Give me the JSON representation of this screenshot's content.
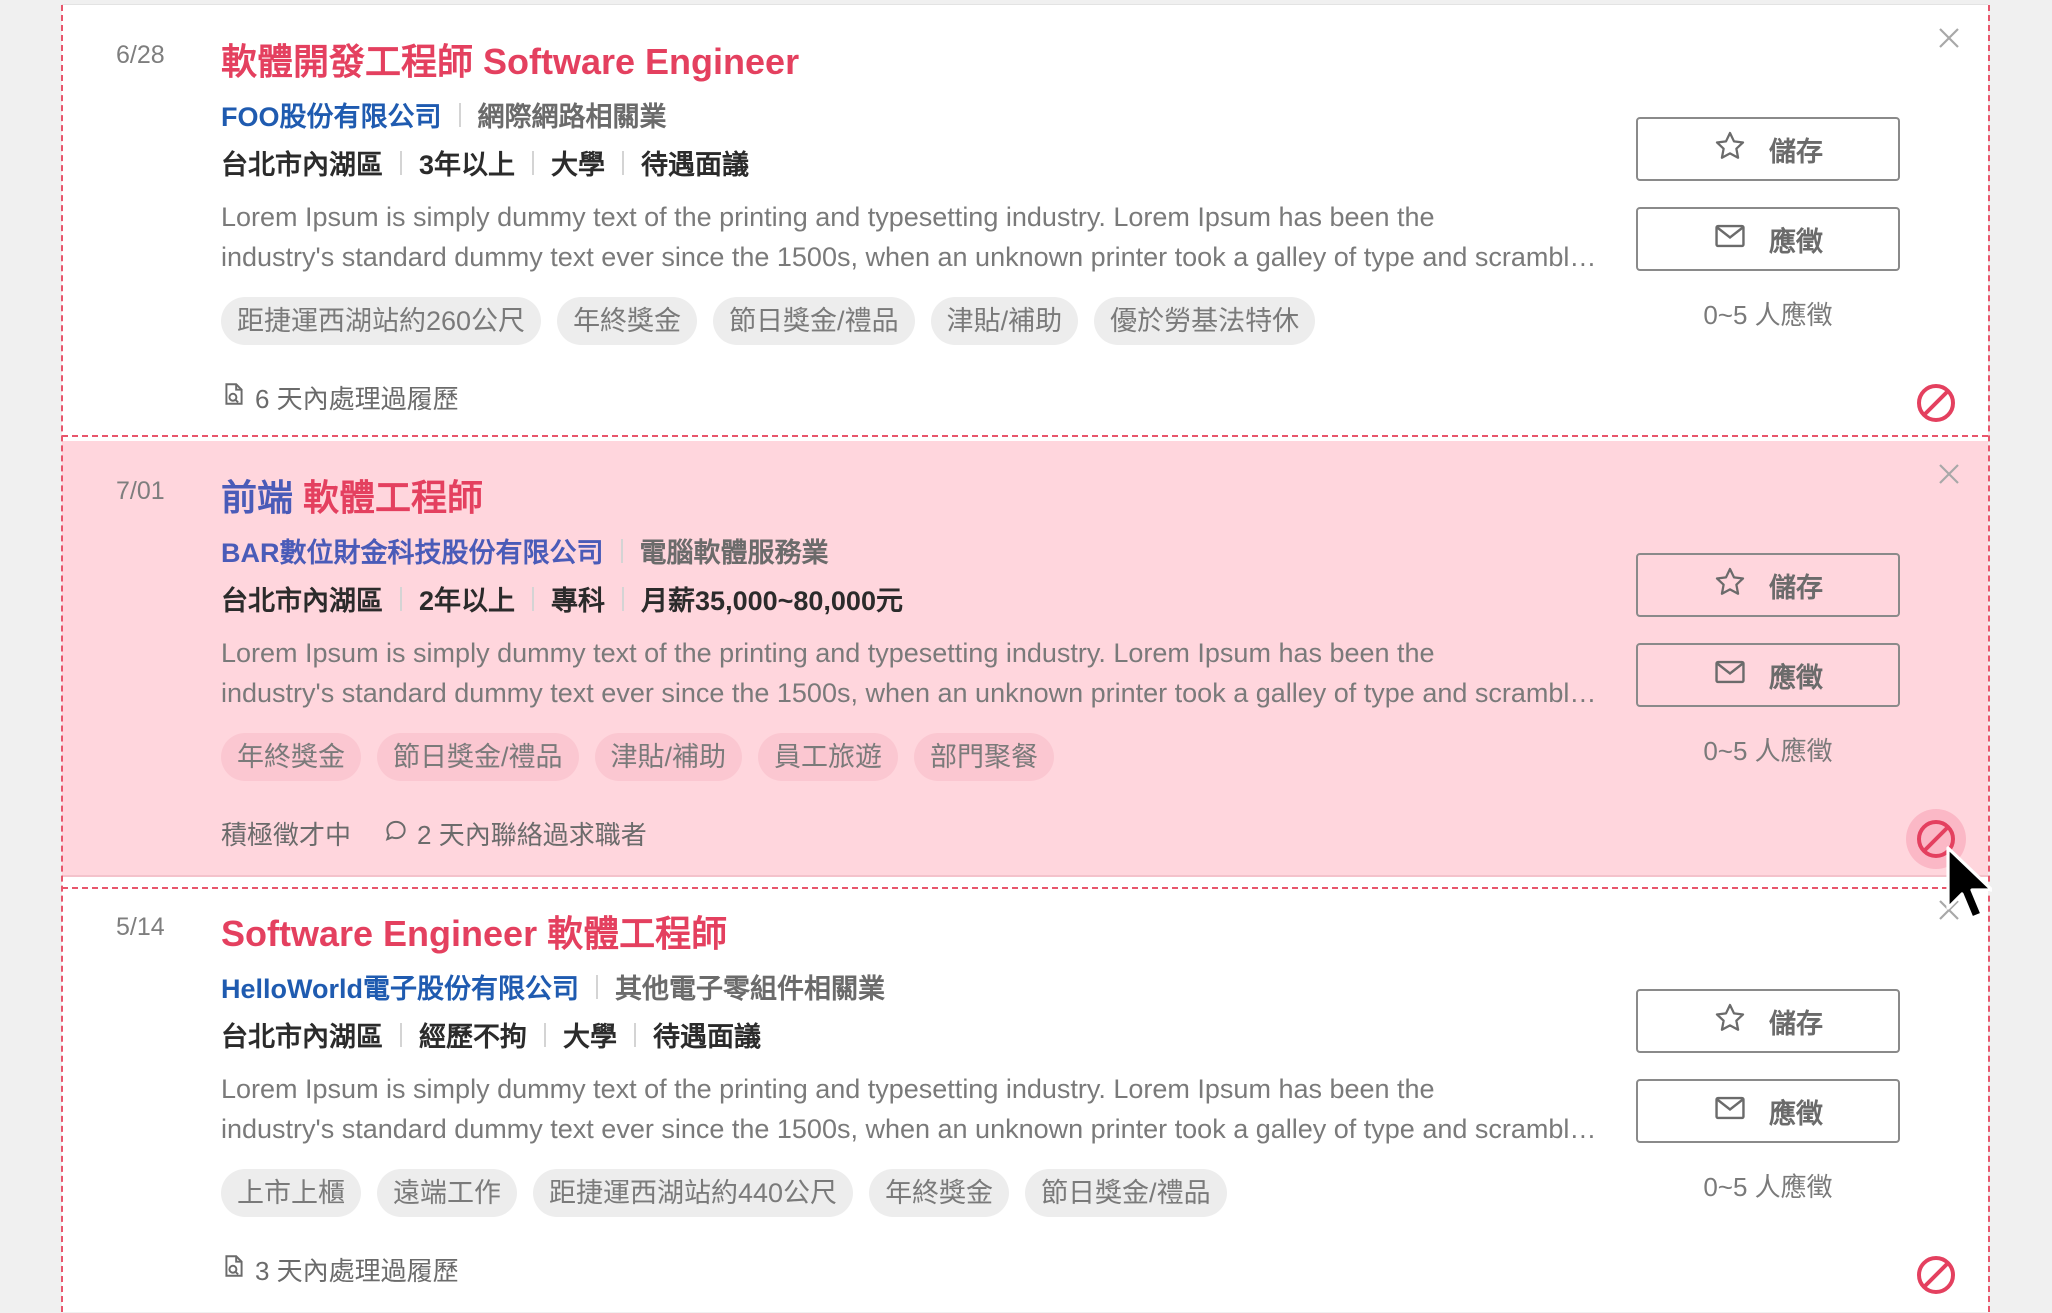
{
  "jobs": [
    {
      "date": "6/28",
      "title_prefix": "",
      "title": "軟體開發工程師 Software Engineer",
      "company": "FOO股份有限公司",
      "industry": "網際網路相關業",
      "meta": [
        "台北市內湖區",
        "3年以上",
        "大學",
        "待遇面議"
      ],
      "desc_lines": [
        "Lorem Ipsum is simply dummy text of the printing and typesetting industry. Lorem Ipsum has been the",
        "industry's standard dummy text ever since the 1500s, when an unknown printer took a galley of type and scrambled it"
      ],
      "tags": [
        "距捷運西湖站約260公尺",
        "年終獎金",
        "節日獎金/禮品",
        "津貼/補助",
        "優於勞基法特休"
      ],
      "activity": "",
      "footnote": "6 天內處理過履歷",
      "footnote_icon": "resume-processed-icon",
      "save_label": "儲存",
      "apply_label": "應徵",
      "apply_count": "0~5 人應徵"
    },
    {
      "date": "7/01",
      "title_prefix": "前端",
      "title": "軟體工程師",
      "company": "BAR數位財金科技股份有限公司",
      "industry": "電腦軟體服務業",
      "meta": [
        "台北市內湖區",
        "2年以上",
        "專科",
        "月薪35,000~80,000元"
      ],
      "desc_lines": [
        "Lorem Ipsum is simply dummy text of the printing and typesetting industry. Lorem Ipsum has been the",
        "industry's standard dummy text ever since the 1500s, when an unknown printer took a galley of type and scrambled it"
      ],
      "tags": [
        "年終獎金",
        "節日獎金/禮品",
        "津貼/補助",
        "員工旅遊",
        "部門聚餐"
      ],
      "activity": "積極徵才中",
      "footnote": "2 天內聯絡過求職者",
      "footnote_icon": "chat-bubble-icon",
      "save_label": "儲存",
      "apply_label": "應徵",
      "apply_count": "0~5 人應徵"
    },
    {
      "date": "5/14",
      "title_prefix": "",
      "title": "Software Engineer 軟體工程師",
      "company": "HelloWorld電子股份有限公司",
      "industry": "其他電子零組件相關業",
      "meta": [
        "台北市內湖區",
        "經歷不拘",
        "大學",
        "待遇面議"
      ],
      "desc_lines": [
        "Lorem Ipsum is simply dummy text of the printing and typesetting industry. Lorem Ipsum has been the",
        "industry's standard dummy text ever since the 1500s, when an unknown printer took a galley of type and scrambled it"
      ],
      "tags": [
        "上市上櫃",
        "遠端工作",
        "距捷運西湖站約440公尺",
        "年終獎金",
        "節日獎金/禮品"
      ],
      "activity": "",
      "footnote": "3 天內處理過履歷",
      "footnote_icon": "resume-processed-icon",
      "save_label": "儲存",
      "apply_label": "應徵",
      "apply_count": "0~5 人應徵"
    }
  ],
  "colors": {
    "title_red": "#e4405f",
    "title_blue": "#4a5bb8",
    "company_blue": "#1f5bb0",
    "hover_bg": "#ffd6dd",
    "block_red": "#e4405f",
    "guide_red": "#e8566c"
  },
  "hovered_card_index": 1
}
